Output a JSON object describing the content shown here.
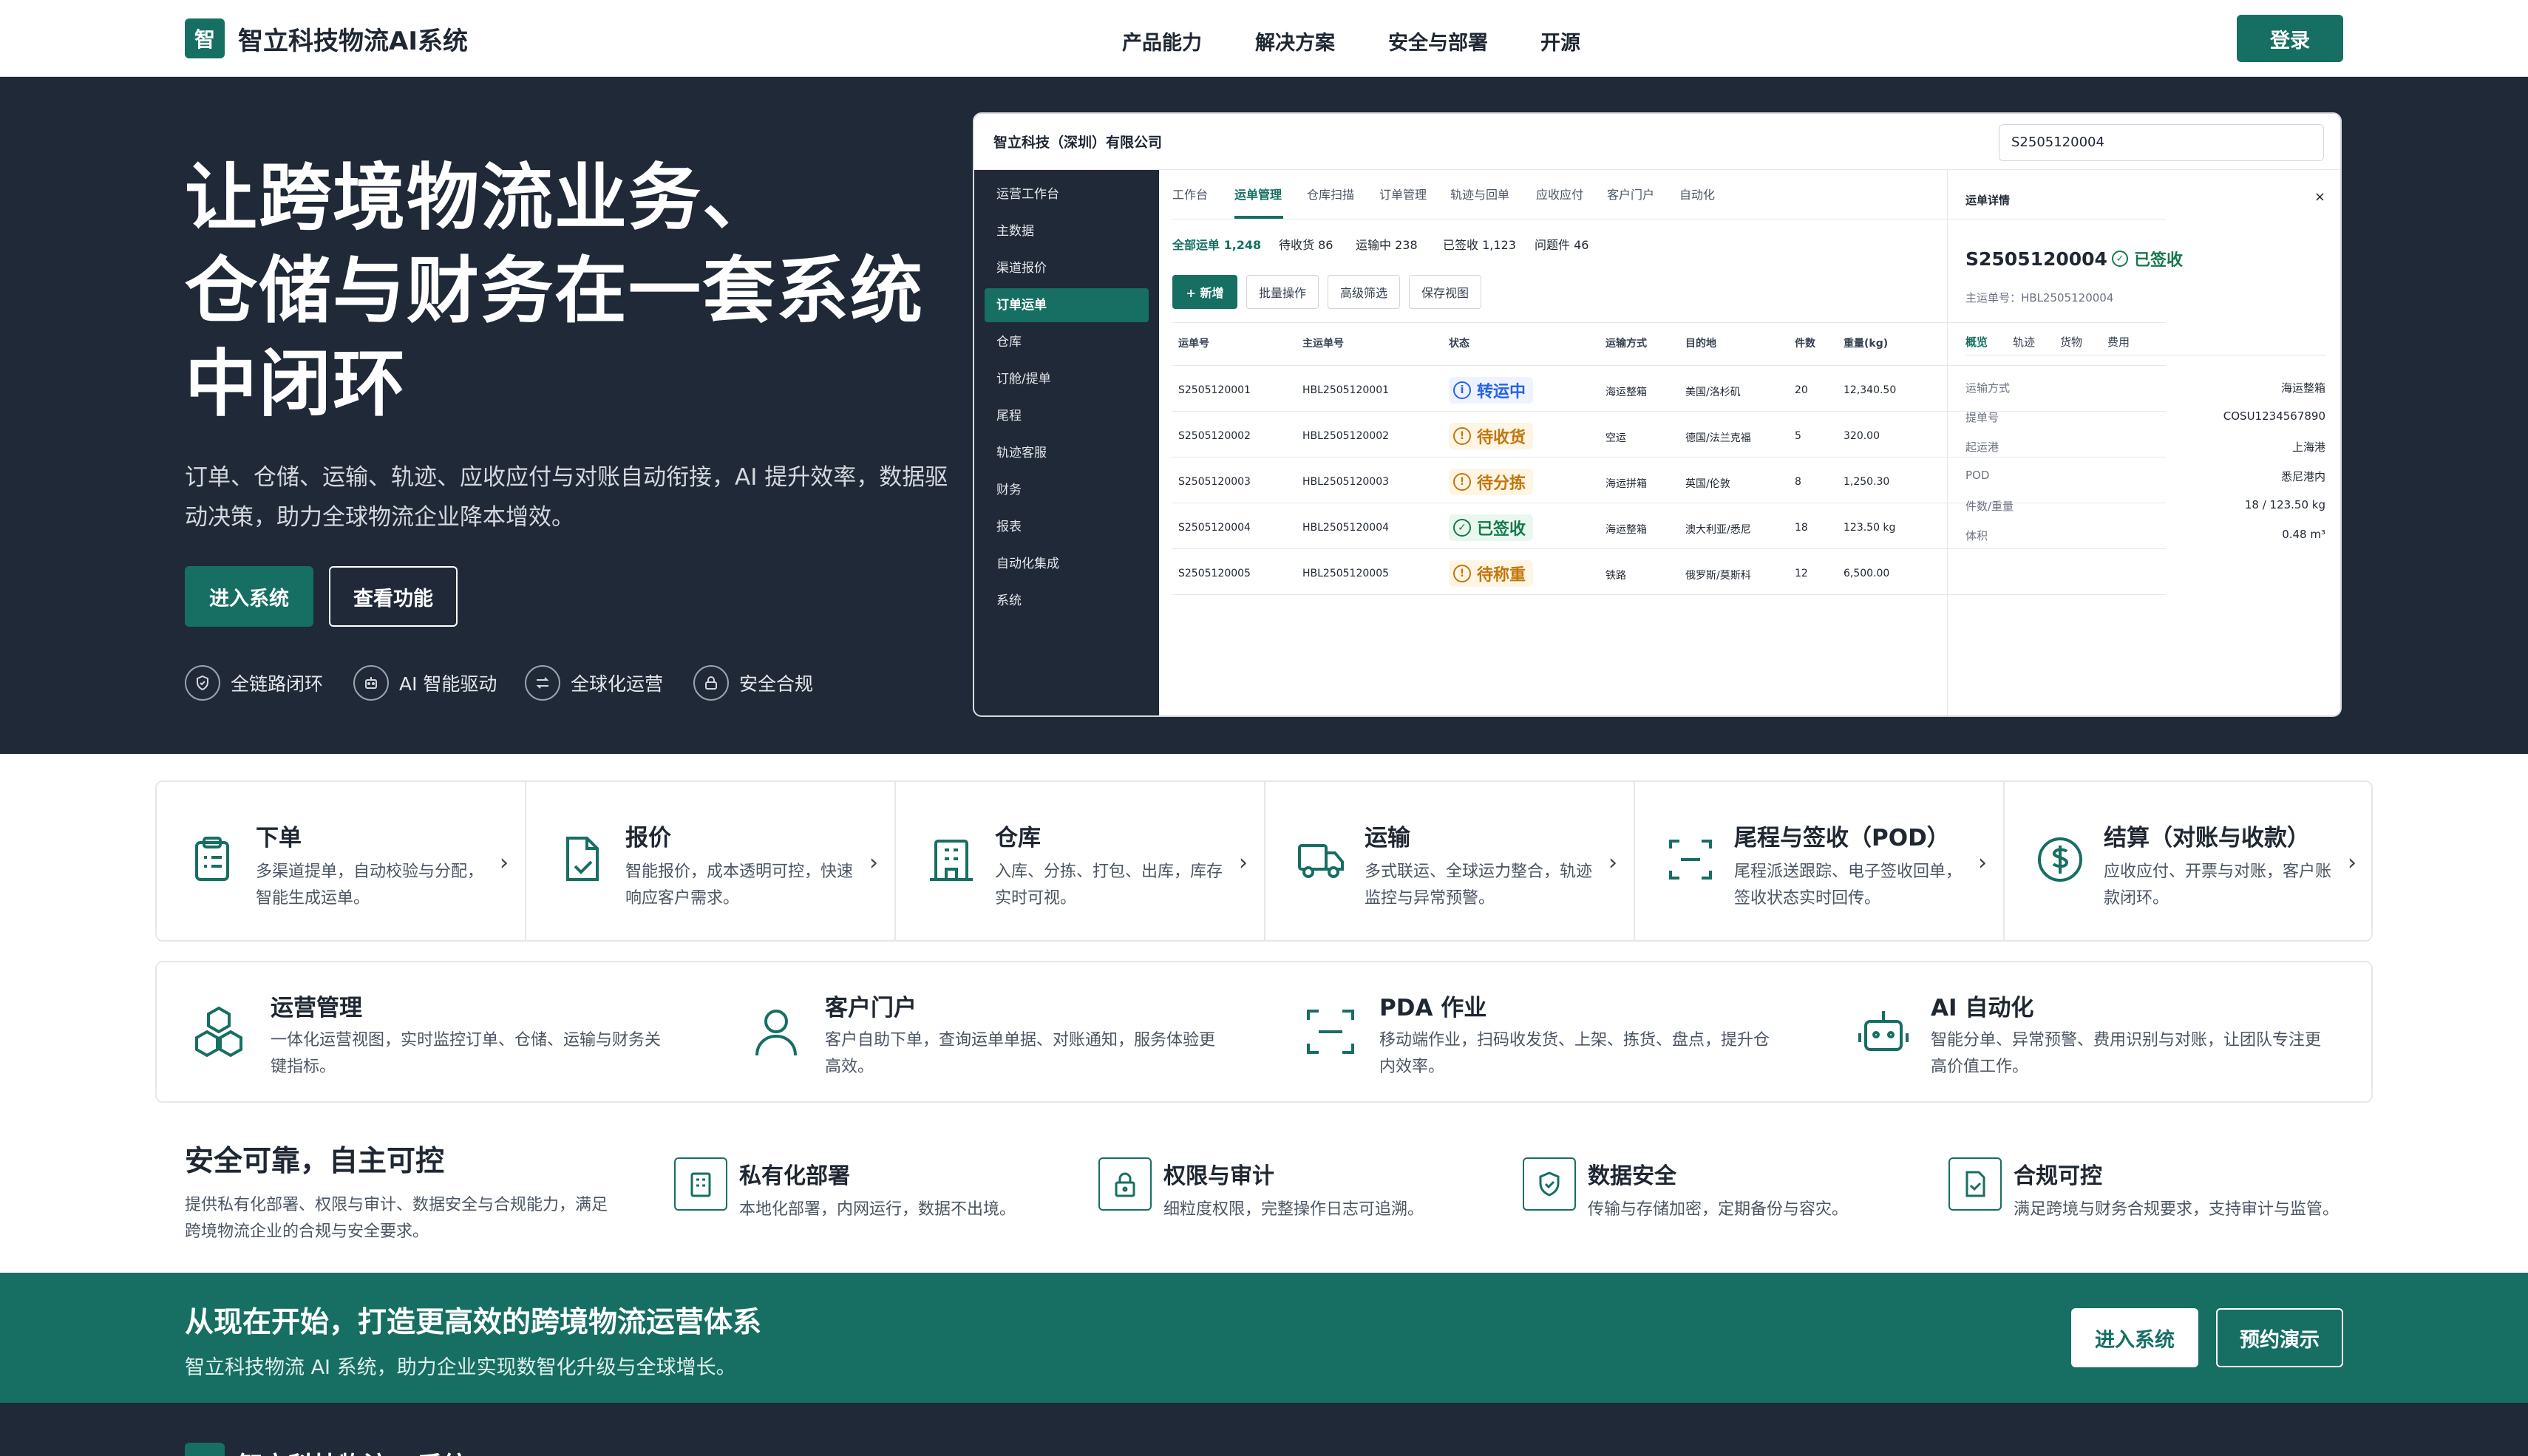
{
  "header": {
    "logo_char": "智",
    "brand": "智立科技物流AI系统",
    "nav": [
      "产品能力",
      "解决方案",
      "安全与部署",
      "开源"
    ],
    "login": "登录"
  },
  "hero": {
    "title_lines": [
      "让跨境物流业务、",
      "仓储与财务在一套系统",
      "中闭环"
    ],
    "sub_lines": [
      "订单、仓储、运输、轨迹、应收应付与对账自动衔接，AI 提升效率，数据驱",
      "动决策，助力全球物流企业降本增效。"
    ],
    "btn_enter": "进入系统",
    "btn_features": "查看功能",
    "features": [
      "全链路闭环",
      "AI 智能驱动",
      "全球化运营",
      "安全合规"
    ]
  },
  "app": {
    "company": "智立科技（深圳）有限公司",
    "search_value": "S2505120004",
    "sidebar": [
      "运营工作台",
      "主数据",
      "渠道报价",
      "订单运单",
      "仓库",
      "订舱/提单",
      "尾程",
      "轨迹客服",
      "财务",
      "报表",
      "自动化集成",
      "系统"
    ],
    "tabs": [
      "工作台",
      "运单管理",
      "仓库扫描",
      "订单管理",
      "轨迹与回单",
      "应收应付",
      "客户门户",
      "自动化"
    ],
    "stats": [
      "全部运单 1,248",
      "待收货 86",
      "运输中 238",
      "已签收 1,123",
      "问题件 46"
    ],
    "toolbar": [
      "+ 新增",
      "批量操作",
      "高级筛选",
      "保存视图"
    ],
    "columns": [
      "运单号",
      "主运单号",
      "状态",
      "运输方式",
      "目的地",
      "件数",
      "重量(kg)"
    ],
    "rows": [
      {
        "id": "S2505120001",
        "master": "HBL2505120001",
        "status": "转运中",
        "mode": "海运整箱",
        "dest": "美国/洛杉矶",
        "qty": "20",
        "weight": "12,340.50"
      },
      {
        "id": "S2505120002",
        "master": "HBL2505120002",
        "status": "待收货",
        "mode": "空运",
        "dest": "德国/法兰克福",
        "qty": "5",
        "weight": "320.00"
      },
      {
        "id": "S2505120003",
        "master": "HBL2505120003",
        "status": "待分拣",
        "mode": "海运拼箱",
        "dest": "英国/伦敦",
        "qty": "8",
        "weight": "1,250.30"
      },
      {
        "id": "S2505120004",
        "master": "HBL2505120004",
        "status": "已签收",
        "mode": "海运整箱",
        "dest": "澳大利亚/悉尼",
        "qty": "18",
        "weight": "123.50 kg"
      },
      {
        "id": "S2505120005",
        "master": "HBL2505120005",
        "status": "待称重",
        "mode": "铁路",
        "dest": "俄罗斯/莫斯科",
        "qty": "12",
        "weight": "6,500.00"
      }
    ],
    "detail": {
      "heading": "运单详情",
      "close": "×",
      "id": "S2505120004",
      "status": "已签收",
      "master": "主运单号：HBL2505120004",
      "tabs": [
        "概览",
        "轨迹",
        "货物",
        "费用"
      ],
      "fields": [
        {
          "label": "运输方式",
          "value": "海运整箱"
        },
        {
          "label": "提单号",
          "value": "COSU1234567890"
        },
        {
          "label": "起运港",
          "value": "上海港"
        },
        {
          "label": "POD",
          "value": "悉尼港内"
        },
        {
          "label": "件数/重量",
          "value": "18 / 123.50 kg"
        },
        {
          "label": "体积",
          "value": "0.48 m³"
        }
      ]
    }
  },
  "flow_cards": [
    {
      "title": "下单",
      "desc": "多渠道提单，自动校验与分配，智能生成运单。"
    },
    {
      "title": "报价",
      "desc": "智能报价，成本透明可控，快速响应客户需求。"
    },
    {
      "title": "仓库",
      "desc": "入库、分拣、打包、出库，库存实时可视。"
    },
    {
      "title": "运输",
      "desc": "多式联运、全球运力整合，轨迹监控与异常预警。"
    },
    {
      "title": "尾程与签收（POD）",
      "desc": "尾程派送跟踪、电子签收回单，签收状态实时回传。"
    },
    {
      "title": "结算（对账与收款）",
      "desc": "应收应付、开票与对账，客户账款闭环。"
    }
  ],
  "ops_cards": [
    {
      "title": "运营管理",
      "desc": "一体化运营视图，实时监控订单、仓储、运输与财务关键指标。"
    },
    {
      "title": "客户门户",
      "desc": "客户自助下单，查询运单单据、对账通知，服务体验更高效。"
    },
    {
      "title": "PDA 作业",
      "desc": "移动端作业，扫码收发货、上架、拣货、盘点，提升仓内效率。"
    },
    {
      "title": "AI 自动化",
      "desc": "智能分单、异常预警、费用识别与对账，让团队专注更高价值工作。"
    }
  ],
  "security": {
    "title": "安全可靠，自主可控",
    "desc_lines": [
      "提供私有化部署、权限与审计、数据安全与合规能力，满足",
      "跨境物流企业的合规与安全要求。"
    ],
    "items": [
      {
        "title": "私有化部署",
        "desc": "本地化部署，内网运行，数据不出境。"
      },
      {
        "title": "权限与审计",
        "desc": "细粒度权限，完整操作日志可追溯。"
      },
      {
        "title": "数据安全",
        "desc": "传输与存储加密，定期备份与容灾。"
      },
      {
        "title": "合规可控",
        "desc": "满足跨境与财务合规要求，支持审计与监管。"
      }
    ]
  },
  "cta": {
    "title": "从现在开始，打造更高效的跨境物流运营体系",
    "sub": "智立科技物流 AI 系统，助力企业实现数智化升级与全球增长。",
    "enter": "进入系统",
    "demo": "预约演示"
  },
  "footer": {
    "brand": "智立科技物流AI系统"
  },
  "colors": {
    "brand": "#166f62",
    "dark": "#1f2937"
  }
}
